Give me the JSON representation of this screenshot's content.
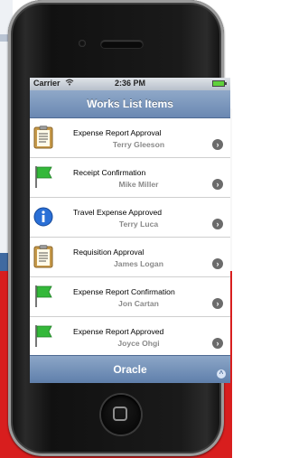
{
  "statusbar": {
    "carrier": "Carrier",
    "time": "2:36 PM"
  },
  "navbar": {
    "title": "Works List Items"
  },
  "items": [
    {
      "title": "Expense Report Approval",
      "subtitle": "Terry Gleeson",
      "icon": "clipboard-icon"
    },
    {
      "title": "Receipt Confirmation",
      "subtitle": "Mike Miller",
      "icon": "green-flag-icon"
    },
    {
      "title": "Travel Expense Approved",
      "subtitle": "Terry Luca",
      "icon": "info-icon"
    },
    {
      "title": "Requisition Approval",
      "subtitle": "James Logan",
      "icon": "clipboard-icon"
    },
    {
      "title": "Expense Report Confirmation",
      "subtitle": "Jon Cartan",
      "icon": "green-flag-icon"
    },
    {
      "title": "Expense Report Approved",
      "subtitle": "Joyce Ohgi",
      "icon": "green-flag-icon"
    }
  ],
  "toolbar": {
    "label": "Oracle"
  },
  "colors": {
    "navbar": "#6a88b2",
    "subtitle": "#8a8a8a",
    "background_red": "#d81e1e"
  }
}
